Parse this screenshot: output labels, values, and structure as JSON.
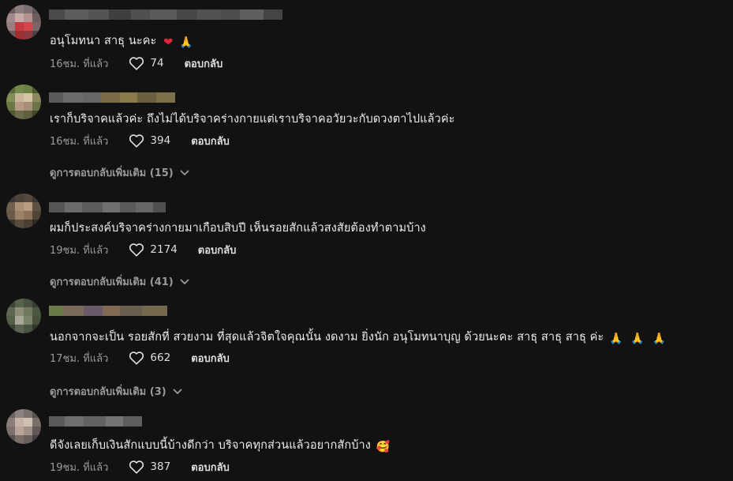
{
  "comments": [
    {
      "text": "อนุโมทนา สาธุ นะคะ",
      "emoji": [
        "❤",
        "🙏"
      ],
      "time": "16ชม. ที่แล้ว",
      "likes": "74",
      "reply_label": "ตอบกลับ",
      "more_replies": ""
    },
    {
      "text": "เราก็บริจาคแล้วค่ะ ถึงไม่ได้บริจาคร่างกายแต่เราบริจาคอวัยวะกับดวงตาไปแล้วค่ะ",
      "emoji": [],
      "time": "16ชม. ที่แล้ว",
      "likes": "394",
      "reply_label": "ตอบกลับ",
      "more_replies": "ดูการตอบกลับเพิ่มเติม (15)"
    },
    {
      "text": "ผมก็ประสงค์บริจาคร่างกายมาเกือบสิบปี เห็นรอยสักแล้วสงสัยต้องทำตามบ้าง",
      "emoji": [],
      "time": "19ชม. ที่แล้ว",
      "likes": "2174",
      "reply_label": "ตอบกลับ",
      "more_replies": "ดูการตอบกลับเพิ่มเติม (41)"
    },
    {
      "text": "นอกจากจะเป็น รอยสักที่ สวยงาม ที่สุดแล้วจิตใจคุณนั้น งดงาม ยิ่งนัก อนุโมทนาบุญ ด้วยนะคะ สาธุ สาธุ สาธุ ค่ะ",
      "emoji": [
        "🙏",
        "🙏",
        "🙏"
      ],
      "time": "17ชม. ที่แล้ว",
      "likes": "662",
      "reply_label": "ตอบกลับ",
      "more_replies": "ดูการตอบกลับเพิ่มเติม (3)"
    },
    {
      "text": "ดีจังเลยเก็บเงินสักแบบนี้บ้างดีกว่า บริจาคทุกส่วนแล้วอยากสักบ้าง",
      "emoji": [
        "🥰"
      ],
      "time": "19ชม. ที่แล้ว",
      "likes": "387",
      "reply_label": "ตอบกลับ",
      "more_replies": ""
    }
  ],
  "icons": {
    "like": "heart-outline-icon",
    "expand": "chevron-down-icon"
  },
  "colors": {
    "background": "#121212",
    "text": "#ececec",
    "muted": "#9a9a9a"
  }
}
